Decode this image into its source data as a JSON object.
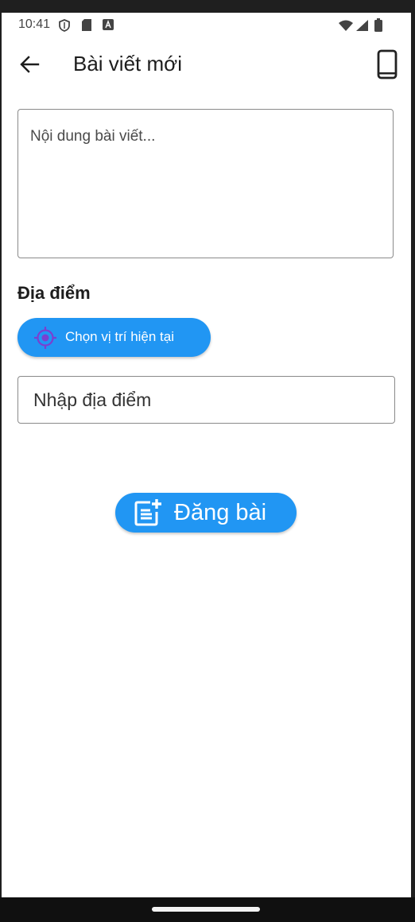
{
  "status_bar": {
    "time": "10:41",
    "left_icons": [
      "shield-icon",
      "sd-card-icon",
      "a-badge-icon"
    ],
    "right_icons": [
      "wifi-icon",
      "signal-icon",
      "battery-icon"
    ]
  },
  "app_bar": {
    "title": "Bài viết mới",
    "back_icon": "arrow-left-icon",
    "action_icon": "smartphone-icon"
  },
  "content_field": {
    "placeholder": "Nội dung bài viết...",
    "value": ""
  },
  "location": {
    "section_title": "Địa điểm",
    "current_location_button": "Chọn vị trí hiện tại",
    "current_location_icon": "crosshair-icon",
    "input_placeholder": "Nhập địa điểm",
    "input_value": ""
  },
  "post_button": {
    "label": "Đăng bài",
    "icon": "post-add-icon"
  },
  "colors": {
    "accent": "#2196f3",
    "location_icon": "#7b3fd0",
    "text_primary": "#1d1d1d"
  }
}
